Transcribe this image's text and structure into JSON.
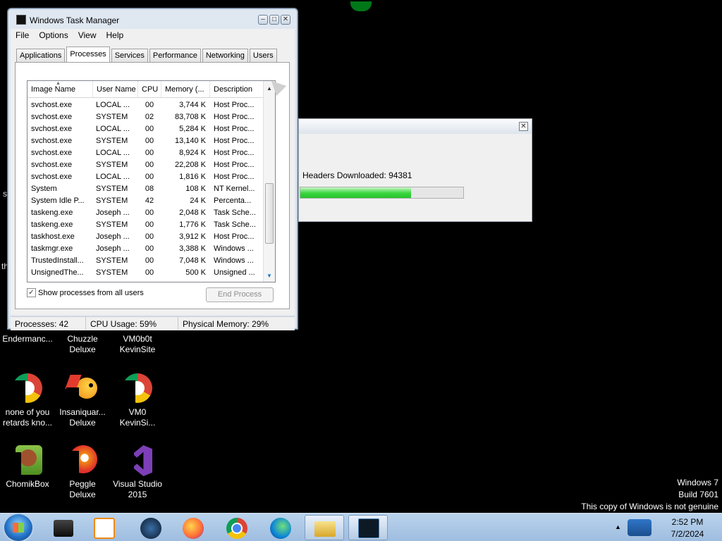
{
  "task_manager": {
    "title": "Windows Task Manager",
    "menu": [
      "File",
      "Options",
      "View",
      "Help"
    ],
    "tabs": [
      "Applications",
      "Processes",
      "Services",
      "Performance",
      "Networking",
      "Users"
    ],
    "active_tab": "Processes",
    "columns": [
      "Image Name",
      "User Name",
      "CPU",
      "Memory (...",
      "Description"
    ],
    "rows": [
      {
        "name": "svchost.exe",
        "user": "LOCAL ...",
        "cpu": "00",
        "mem": "3,744 K",
        "desc": "Host Proc..."
      },
      {
        "name": "svchost.exe",
        "user": "SYSTEM",
        "cpu": "02",
        "mem": "83,708 K",
        "desc": "Host Proc..."
      },
      {
        "name": "svchost.exe",
        "user": "LOCAL ...",
        "cpu": "00",
        "mem": "5,284 K",
        "desc": "Host Proc..."
      },
      {
        "name": "svchost.exe",
        "user": "SYSTEM",
        "cpu": "00",
        "mem": "13,140 K",
        "desc": "Host Proc..."
      },
      {
        "name": "svchost.exe",
        "user": "LOCAL ...",
        "cpu": "00",
        "mem": "8,924 K",
        "desc": "Host Proc..."
      },
      {
        "name": "svchost.exe",
        "user": "SYSTEM",
        "cpu": "00",
        "mem": "22,208 K",
        "desc": "Host Proc..."
      },
      {
        "name": "svchost.exe",
        "user": "LOCAL ...",
        "cpu": "00",
        "mem": "1,816 K",
        "desc": "Host Proc..."
      },
      {
        "name": "System",
        "user": "SYSTEM",
        "cpu": "08",
        "mem": "108 K",
        "desc": "NT Kernel..."
      },
      {
        "name": "System Idle P...",
        "user": "SYSTEM",
        "cpu": "42",
        "mem": "24 K",
        "desc": "Percenta..."
      },
      {
        "name": "taskeng.exe",
        "user": "Joseph ...",
        "cpu": "00",
        "mem": "2,048 K",
        "desc": "Task Sche..."
      },
      {
        "name": "taskeng.exe",
        "user": "SYSTEM",
        "cpu": "00",
        "mem": "1,776 K",
        "desc": "Task Sche..."
      },
      {
        "name": "taskhost.exe",
        "user": "Joseph ...",
        "cpu": "00",
        "mem": "3,912 K",
        "desc": "Host Proc..."
      },
      {
        "name": "taskmgr.exe",
        "user": "Joseph ...",
        "cpu": "00",
        "mem": "3,388 K",
        "desc": "Windows ..."
      },
      {
        "name": "TrustedInstall...",
        "user": "SYSTEM",
        "cpu": "00",
        "mem": "7,048 K",
        "desc": "Windows ..."
      },
      {
        "name": "UnsignedThe...",
        "user": "SYSTEM",
        "cpu": "00",
        "mem": "500 K",
        "desc": "Unsigned ..."
      }
    ],
    "show_all_label": "Show processes from all users",
    "show_all_checked": true,
    "end_process_label": "End Process",
    "status": {
      "processes": "Processes: 42",
      "cpu": "CPU Usage: 59%",
      "memory": "Physical Memory: 29%"
    }
  },
  "downloader": {
    "status_text": "Headers Downloaded: 94381",
    "progress_fraction": 0.68
  },
  "desktop_fragments": {
    "left1": "s",
    "left2": "th"
  },
  "desktop_icons": [
    {
      "label": "Endermanc...",
      "icon": "app-icon"
    },
    {
      "label": "Chuzzle Deluxe",
      "icon": "app-icon"
    },
    {
      "label": "VM0b0t KevinSite",
      "icon": "app-icon"
    },
    {
      "label": "none of you retards kno...",
      "icon": "chrome-icon"
    },
    {
      "label": "Insaniquar... Deluxe",
      "icon": "fish-icon"
    },
    {
      "label": "VM0 KevinSi...",
      "icon": "chrome-icon"
    },
    {
      "label": "ChomikBox",
      "icon": "chomikbox-icon"
    },
    {
      "label": "Peggle Deluxe",
      "icon": "peggle-icon"
    },
    {
      "label": "Visual Studio 2015",
      "icon": "visual-studio-icon"
    }
  ],
  "watermark": {
    "line1": "Windows 7",
    "line2": "Build 7601",
    "line3": "This copy of Windows is not genuine"
  },
  "clock": {
    "time": "2:52 PM",
    "date": "7/2/2024"
  },
  "taskbar": [
    "start-button",
    "terminal-icon",
    "media-player-icon",
    "game-icon",
    "firefox-icon",
    "chrome-icon",
    "edge-icon",
    "explorer-icon",
    "task-manager-icon"
  ]
}
